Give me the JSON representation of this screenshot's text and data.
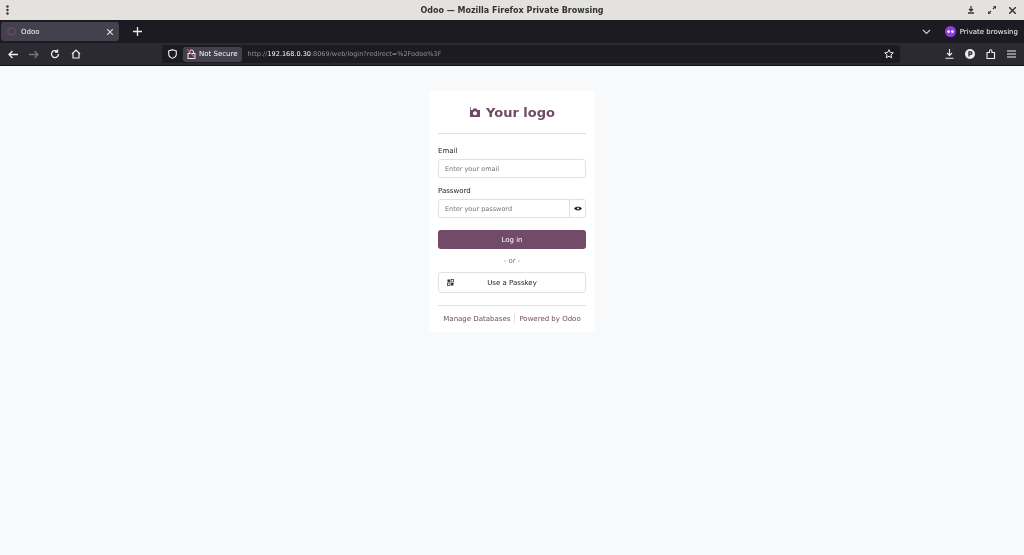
{
  "window": {
    "title": "Odoo — Mozilla Firefox Private Browsing"
  },
  "tabs": [
    {
      "label": "Odoo",
      "selected": true
    }
  ],
  "private_label": "Private browsing",
  "address_bar": {
    "security": "Not Secure",
    "url_scheme": "http://",
    "url_host": "192.168.0.30",
    "url_rest": ":8069/web/login?redirect=%2Fodoo%3F"
  },
  "login": {
    "logo_text": "Your logo",
    "email_label": "Email",
    "email_placeholder": "Enter your email",
    "password_label": "Password",
    "password_placeholder": "Enter your password",
    "login_button": "Log in",
    "separator": "- or -",
    "passkey_button": "Use a Passkey",
    "footer_links": [
      "Manage Databases",
      "Powered by Odoo"
    ]
  }
}
